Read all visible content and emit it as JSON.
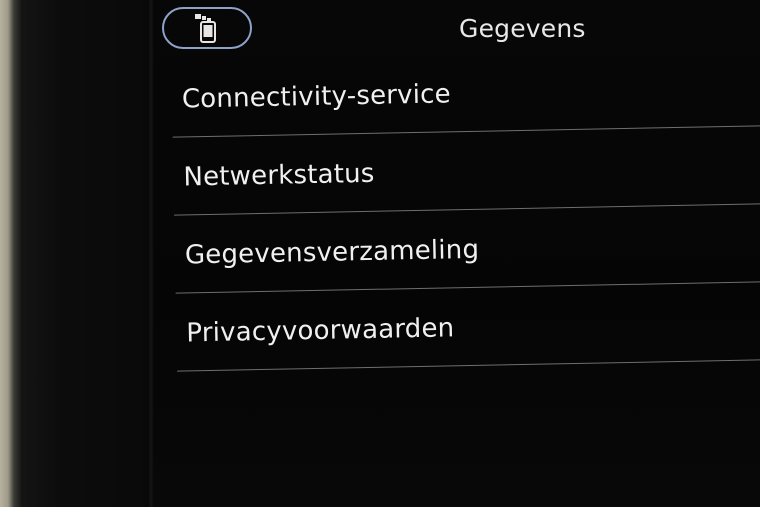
{
  "header": {
    "title": "Gegevens",
    "back_icon": "phone-data-icon"
  },
  "menu": {
    "items": [
      {
        "label": "Connectivity-service"
      },
      {
        "label": "Netwerkstatus"
      },
      {
        "label": "Gegevensverzameling",
        "has_toggle": true
      },
      {
        "label": "Privacyvoorwaarden"
      }
    ]
  },
  "colors": {
    "accent_outline": "#8fa2c8",
    "text": "#f0f0f0",
    "divider": "#6e6e6e",
    "background": "#060606"
  }
}
